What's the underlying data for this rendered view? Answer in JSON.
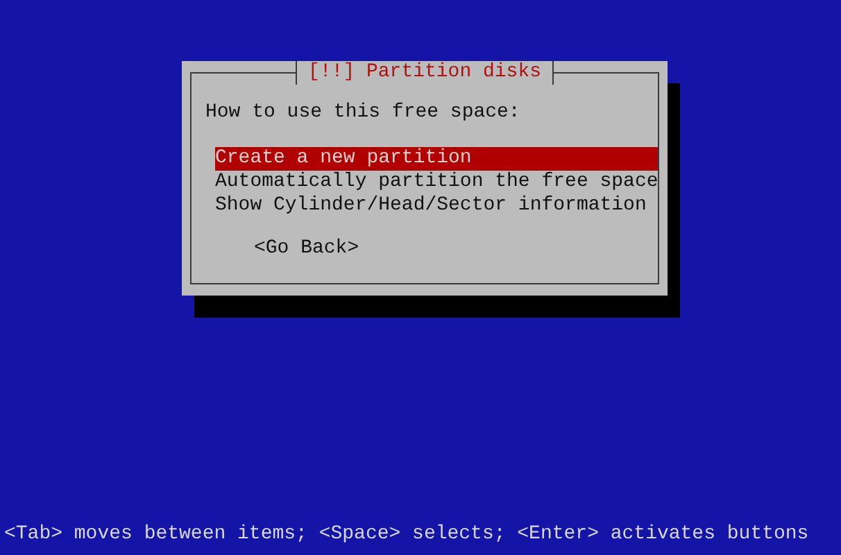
{
  "dialog": {
    "title": "[!!] Partition disks",
    "prompt": "How to use this free space:",
    "options": [
      {
        "label": "Create a new partition",
        "selected": true
      },
      {
        "label": "Automatically partition the free space",
        "selected": false
      },
      {
        "label": "Show Cylinder/Head/Sector information",
        "selected": false
      }
    ],
    "buttons": [
      "<Go Back>"
    ]
  },
  "status_bar": "<Tab> moves between items; <Space> selects; <Enter> activates buttons"
}
